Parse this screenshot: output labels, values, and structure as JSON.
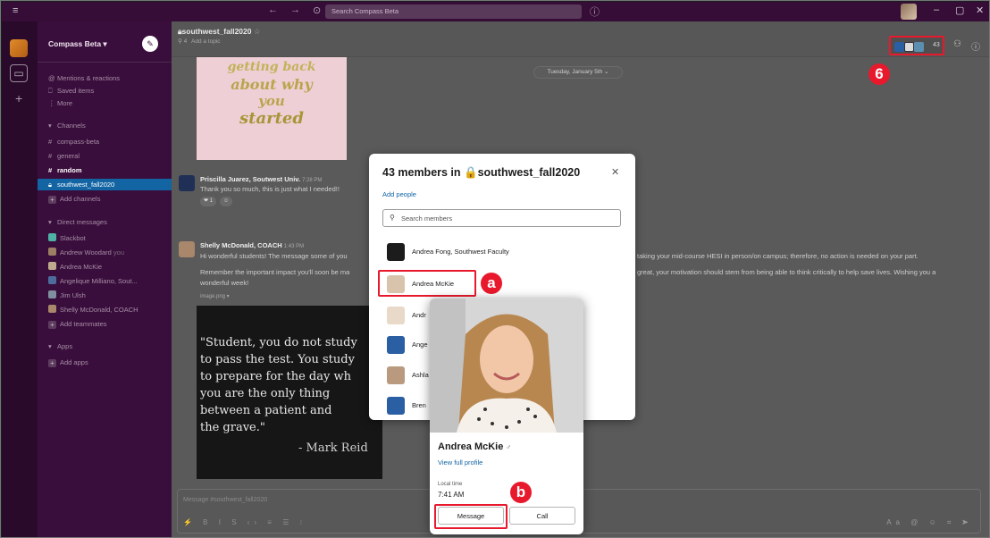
{
  "topbar": {
    "search_placeholder": "Search Compass Beta",
    "nav_back": "←",
    "nav_forward": "→",
    "history": "⊙",
    "help": "ⓘ",
    "win_min": "–",
    "win_max": "▢",
    "win_close": "✕"
  },
  "workspace": {
    "name": "Compass Beta ▾"
  },
  "sidebar": {
    "mentions": "Mentions & reactions",
    "saved": "Saved items",
    "more": "More",
    "channels_header": "Channels",
    "channels": [
      "compass-beta",
      "general",
      "random",
      "southwest_fall2020"
    ],
    "add_channels": "Add channels",
    "dm_header": "Direct messages",
    "dms": [
      "Slackbot",
      "Andrew Woodard",
      "Andrea McKie",
      "Angelique Milliano, Sout...",
      "Jim Ulsh",
      "Shelly McDonald, COACH"
    ],
    "dm_you": "you",
    "add_teammates": "Add teammates",
    "apps_header": "Apps",
    "add_apps": "Add apps"
  },
  "channel": {
    "name": "southwest_fall2020",
    "star": "☆",
    "topic_count": "4",
    "topic_add": "Add a topic",
    "member_count": "43",
    "date_pill": "Tuesday, January 5th ⌄"
  },
  "messages": [
    {
      "author": "Priscilla Juarez, Soutwest Univ.",
      "time": "7:28 PM",
      "text": "Thank you so much, this is just what I needed!!",
      "reaction_count": "1"
    },
    {
      "author": "Shelly McDonald, COACH",
      "time": "1:43 PM",
      "text1": "Hi wonderful students! The message some of you",
      "text1_right": "taking your mid-course HESI in person/on campus; therefore, no action is needed on your part.",
      "text2": "Remember the important impact you'll soon be ma",
      "text2_right": "great, your motivation should stem from being able to think critically to help save lives. Wishing you a",
      "text3": "wonderful week!",
      "attachment": "image.png ▾"
    }
  ],
  "motivation_image": {
    "line1": "getting back",
    "line2": "about why",
    "line3": "you",
    "line4": "started"
  },
  "quote": {
    "lines": [
      "\"Student, you do not study",
      "to pass the test. You study",
      "to prepare for the day wh",
      "you are the only thing",
      "between a patient and",
      "the grave.\""
    ],
    "author": "- Mark Reid"
  },
  "composer": {
    "placeholder": "Message #southwest_fall2020"
  },
  "modal": {
    "title": "43 members in 🔒southwest_fall2020",
    "close": "✕",
    "add_people": "Add people",
    "search_placeholder": "Search members",
    "members": [
      "Andrea Fong, Southwest Faculty",
      "Andrea McKie",
      "Andr",
      "Ange",
      "Ashla",
      "Bren"
    ]
  },
  "profile": {
    "name": "Andrea McKie",
    "view_profile": "View full profile",
    "local_time_label": "Local time",
    "local_time": "7:41 AM",
    "message_btn": "Message",
    "call_btn": "Call"
  },
  "annotations": {
    "six": "6",
    "a": "a",
    "b": "b"
  },
  "colors": {
    "sidebar": "#3a0e3c",
    "topbar": "#350d36",
    "active": "#1264a3",
    "highlight": "#e8192c",
    "link": "#1264a3"
  }
}
